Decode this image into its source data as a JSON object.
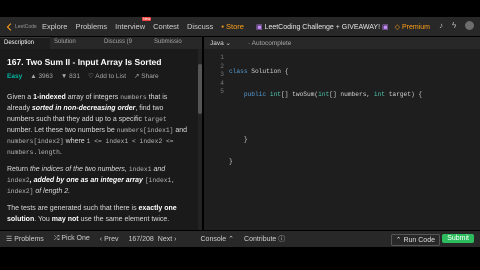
{
  "nav": {
    "logo_text": "LeetCode",
    "links": [
      "Explore",
      "Problems",
      "Interview",
      "Contest",
      "Discuss"
    ],
    "new_badge": "New",
    "store": "Store",
    "promo": "LeetCoding Challenge + GIVEAWAY!",
    "premium": "Premium"
  },
  "tabs": [
    "Description",
    "Solution",
    "Discuss (9",
    "Submissio"
  ],
  "problem": {
    "title": "167. Two Sum II - Input Array Is Sorted",
    "difficulty": "Easy",
    "likes": "3963",
    "dislikes": "831",
    "add_to_list": "Add to List",
    "share": "Share"
  },
  "description": {
    "p1a": "Given a ",
    "p1b": "1-indexed",
    "p1c": " array of integers ",
    "p1d": "numbers",
    "p1e": " that is already ",
    "p1f": "sorted in non-decreasing order",
    "p1g": ", find two numbers such that they add up to a specific ",
    "p1h": "target",
    "p1i": " number. Let these two numbers be ",
    "p1j": "numbers[index1]",
    "p1k": " and ",
    "p1l": "numbers[index2]",
    "p1m": " where ",
    "p1n": "1 <= index1 < index2 <= numbers.length",
    "p1o": ".",
    "p2a": "Return ",
    "p2b": "the indices of the two numbers, ",
    "p2c": "index1",
    "p2d": " and ",
    "p2e": "index2",
    "p2f": ", added by one as an integer array ",
    "p2g": "[index1, index2]",
    "p2h": " of length 2.",
    "p3a": "The tests are generated such that there is ",
    "p3b": "exactly one solution",
    "p3c": ". You ",
    "p3d": "may not",
    "p3e": " use the same element twice."
  },
  "editor": {
    "language": "Java",
    "autocomplete": "Autocomplete",
    "lines": [
      "1",
      "2",
      "3",
      "4",
      "5"
    ]
  },
  "bottom": {
    "problems": "Problems",
    "pick_one": "Pick One",
    "prev": "Prev",
    "page": "167/208",
    "next": "Next",
    "console": "Console",
    "contribute": "Contribute",
    "run_code": "Run Code",
    "submit": "Submit"
  }
}
